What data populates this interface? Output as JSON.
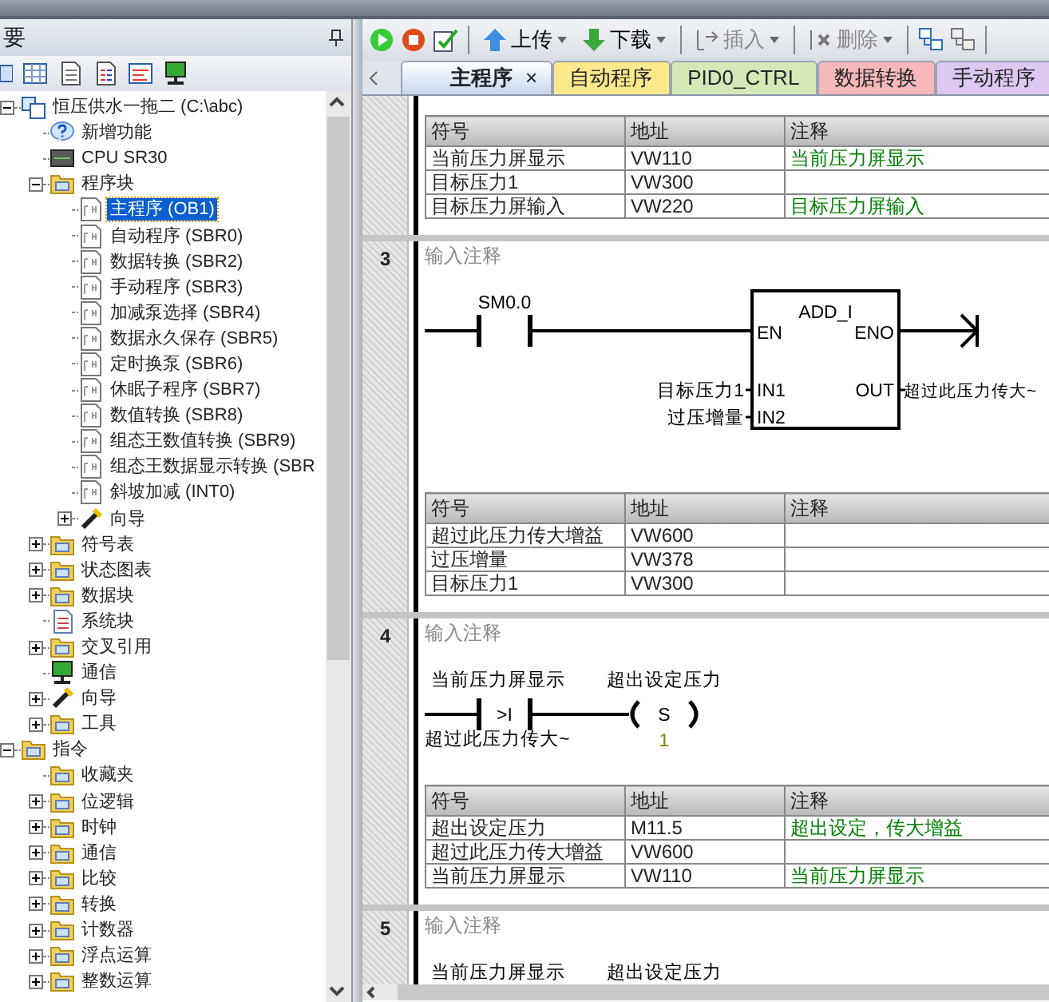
{
  "panel": {
    "title": "要"
  },
  "tree": [
    {
      "label": "恒压供水一拖二 (C:\\abc)",
      "kind": "project",
      "expanded": true,
      "selected": false,
      "children": [
        {
          "label": "新增功能",
          "kind": "help",
          "selected": false
        },
        {
          "label": "CPU SR30",
          "kind": "cpu",
          "selected": false
        },
        {
          "label": "程序块",
          "kind": "folder",
          "expanded": true,
          "selected": false,
          "children": [
            {
              "label": "主程序 (OB1)",
              "kind": "page",
              "selected": true
            },
            {
              "label": "自动程序 (SBR0)",
              "kind": "page",
              "selected": false
            },
            {
              "label": "数据转换 (SBR2)",
              "kind": "page",
              "selected": false
            },
            {
              "label": "手动程序 (SBR3)",
              "kind": "page",
              "selected": false
            },
            {
              "label": "加减泵选择 (SBR4)",
              "kind": "page",
              "selected": false
            },
            {
              "label": "数据永久保存 (SBR5)",
              "kind": "page",
              "selected": false
            },
            {
              "label": "定时换泵 (SBR6)",
              "kind": "page",
              "selected": false
            },
            {
              "label": "休眠子程序 (SBR7)",
              "kind": "page",
              "selected": false
            },
            {
              "label": "数值转换 (SBR8)",
              "kind": "page",
              "selected": false
            },
            {
              "label": "组态王数值转换 (SBR9)",
              "kind": "page",
              "selected": false
            },
            {
              "label": "组态王数据显示转换 (SBR",
              "kind": "page",
              "selected": false
            },
            {
              "label": "斜坡加减 (INT0)",
              "kind": "page",
              "selected": false
            },
            {
              "label": "向导",
              "kind": "wizard",
              "expanded": false,
              "selected": false
            }
          ]
        },
        {
          "label": "符号表",
          "kind": "folder",
          "expanded": false,
          "selected": false
        },
        {
          "label": "状态图表",
          "kind": "folder",
          "expanded": false,
          "selected": false
        },
        {
          "label": "数据块",
          "kind": "folder",
          "expanded": false,
          "selected": false
        },
        {
          "label": "系统块",
          "kind": "doc",
          "selected": false
        },
        {
          "label": "交叉引用",
          "kind": "folder",
          "expanded": false,
          "selected": false
        },
        {
          "label": "通信",
          "kind": "monitor",
          "selected": false
        },
        {
          "label": "向导",
          "kind": "wizard",
          "expanded": false,
          "selected": false
        },
        {
          "label": "工具",
          "kind": "folder",
          "expanded": false,
          "selected": false
        }
      ]
    },
    {
      "label": "指令",
      "kind": "folder",
      "expanded": true,
      "selected": false,
      "children": [
        {
          "label": "收藏夹",
          "kind": "folder",
          "selected": false
        },
        {
          "label": "位逻辑",
          "kind": "folder",
          "expanded": false,
          "selected": false
        },
        {
          "label": "时钟",
          "kind": "folder",
          "expanded": false,
          "selected": false
        },
        {
          "label": "通信",
          "kind": "folder",
          "expanded": false,
          "selected": false
        },
        {
          "label": "比较",
          "kind": "folder",
          "expanded": false,
          "selected": false
        },
        {
          "label": "转换",
          "kind": "folder",
          "expanded": false,
          "selected": false
        },
        {
          "label": "计数器",
          "kind": "folder",
          "expanded": false,
          "selected": false
        },
        {
          "label": "浮点运算",
          "kind": "folder",
          "expanded": false,
          "selected": false
        },
        {
          "label": "整数运算",
          "kind": "folder",
          "expanded": false,
          "selected": false
        }
      ]
    }
  ],
  "toolbar": [
    {
      "label": "上传",
      "kind": "upload",
      "dropdown": true,
      "disabled": false
    },
    {
      "label": "下载",
      "kind": "download",
      "dropdown": true,
      "disabled": false
    },
    {
      "label": "插入",
      "kind": "insert",
      "dropdown": true,
      "disabled": true
    },
    {
      "label": "删除",
      "kind": "delete",
      "dropdown": true,
      "disabled": true
    }
  ],
  "tabs": [
    {
      "label": "主程序",
      "selected": true,
      "color": "#e4ecf8",
      "close": "×"
    },
    {
      "label": "自动程序",
      "selected": false,
      "color": "#fde98c"
    },
    {
      "label": "PID0_CTRL",
      "selected": false,
      "color": "#d6e8b8"
    },
    {
      "label": "数据转换",
      "selected": false,
      "color": "#f6b8b8"
    },
    {
      "label": "手动程序",
      "selected": false,
      "color": "#dcc8f0"
    }
  ],
  "networks": [
    {
      "symbols": {
        "columns": [
          "符号",
          "地址",
          "注释"
        ],
        "rows": [
          {
            "symbol": "当前压力屏显示",
            "address": "VW110",
            "comment": "当前压力屏显示"
          },
          {
            "symbol": "目标压力1",
            "address": "VW300"
          },
          {
            "symbol": "目标压力屏输入",
            "address": "VW220",
            "comment": "目标压力屏输入"
          }
        ]
      }
    },
    {
      "number": "3",
      "comment": "输入注释",
      "rung": {
        "kind": "box",
        "contact": "SM0.0",
        "box_title": "ADD_I",
        "en": "EN",
        "eno": "ENO",
        "in1": "IN1",
        "in2": "IN2",
        "out": "OUT",
        "in1_operand": "目标压力1",
        "in2_operand": "过压增量",
        "out_operand": "超过此压力传大~"
      },
      "symbols": {
        "columns": [
          "符号",
          "地址",
          "注释"
        ],
        "rows": [
          {
            "symbol": "超过此压力传大增益",
            "address": "VW600"
          },
          {
            "symbol": "过压增量",
            "address": "VW378"
          },
          {
            "symbol": "目标压力1",
            "address": "VW300"
          }
        ]
      }
    },
    {
      "number": "4",
      "comment": "输入注释",
      "rung": {
        "kind": "compare",
        "top_operand": "当前压力屏显示",
        "contact": ">I",
        "bottom_operand": "超过此压力传大~",
        "coil_operand": "超出设定压力",
        "coil": "S",
        "coil_count": "1"
      },
      "symbols": {
        "columns": [
          "符号",
          "地址",
          "注释"
        ],
        "rows": [
          {
            "symbol": "超出设定压力",
            "address": "M11.5",
            "comment": "超出设定，传大增益"
          },
          {
            "symbol": "超过此压力传大增益",
            "address": "VW600"
          },
          {
            "symbol": "当前压力屏显示",
            "address": "VW110",
            "comment": "当前压力屏显示"
          }
        ]
      }
    },
    {
      "number": "5",
      "comment": "输入注释",
      "rung": {
        "kind": "compare",
        "top_operand": "当前压力屏显示",
        "coil_operand": "超出设定压力"
      }
    }
  ]
}
